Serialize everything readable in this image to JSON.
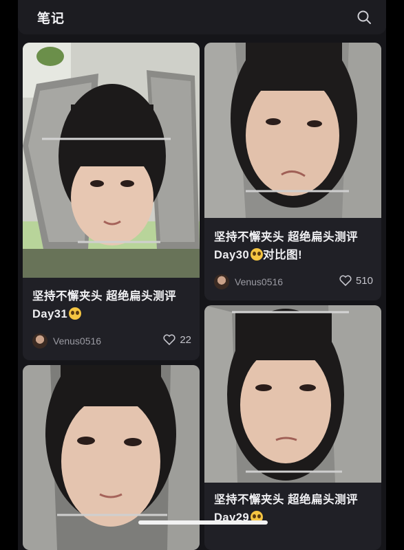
{
  "header": {
    "title": "笔记",
    "search_icon": "search-icon"
  },
  "cards": [
    {
      "title": "坚持不懈夹头 超绝扁头测评Day31",
      "emoji": "pleading-face",
      "author": "Venus0516",
      "likes": "22"
    },
    {
      "title": "坚持不懈夹头 超绝扁头测评Day30",
      "emoji": "pleading-face",
      "title_suffix": "对比图!",
      "author": "Venus0516",
      "likes": "510"
    },
    {
      "title": "",
      "author": "",
      "likes": ""
    },
    {
      "title": "坚持不懈夹头 超绝扁头测评Day29",
      "emoji": "pleading-face"
    }
  ],
  "colors": {
    "background": "#151519",
    "card": "#202026",
    "text": "#f0f0f3",
    "muted": "#9b9ba3"
  }
}
